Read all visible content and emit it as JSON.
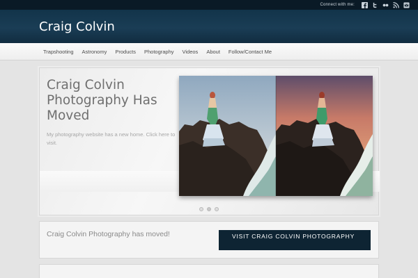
{
  "topbar": {
    "connect_label": "Connect with me:",
    "social": [
      {
        "icon": "facebook-icon"
      },
      {
        "icon": "twitter-icon"
      },
      {
        "icon": "flickr-icon"
      },
      {
        "icon": "rss-icon"
      },
      {
        "icon": "email-icon"
      }
    ]
  },
  "header": {
    "site_title": "Craig Colvin"
  },
  "nav": {
    "items": [
      "Trapshooting",
      "Astronomy",
      "Products",
      "Photography",
      "Videos",
      "About",
      "Follow/Contact Me"
    ]
  },
  "slider": {
    "title": "Craig Colvin Photography Has Moved",
    "description": "My photography website has a new home. Click here to visit.",
    "image_icon": "mermaid-photo",
    "dots": 3,
    "active_dot": 1
  },
  "moved": {
    "text": "Craig Colvin Photography has moved!",
    "button_label": "Visit Craig Colvin Photography"
  },
  "colors": {
    "header_bg": "#12344a",
    "topbar_bg": "#0a1a26",
    "button_bg": "#0e2433"
  }
}
